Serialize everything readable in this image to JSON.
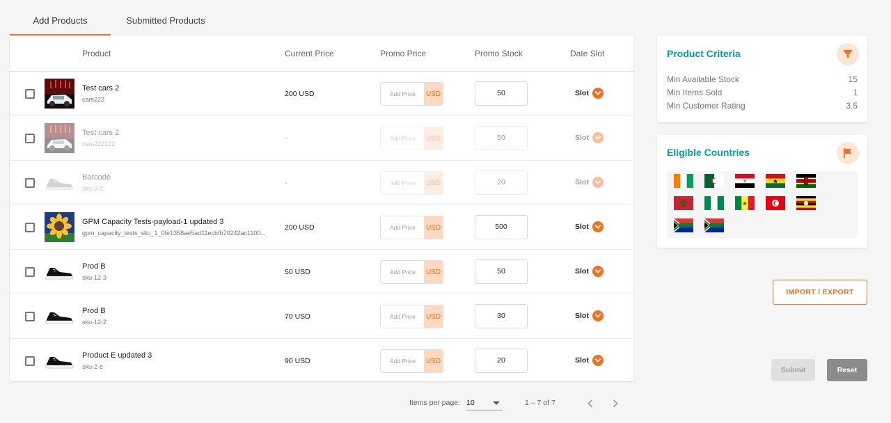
{
  "tabs": [
    {
      "label": "Add Products",
      "active": true
    },
    {
      "label": "Submitted Products",
      "active": false
    }
  ],
  "table": {
    "headers": {
      "product": "Product",
      "current_price": "Current Price",
      "promo_price": "Promo Price",
      "promo_stock": "Promo Stock",
      "date_slot": "Date Slot"
    },
    "rows": [
      {
        "name": "Test cars 2",
        "sku": "cars222",
        "current_price": "200 USD",
        "promo_placeholder": "Add Price",
        "currency": "USD",
        "stock": "50",
        "slot": "Slot",
        "disabled": false
      },
      {
        "name": "Test cars 2",
        "sku": "cars222222",
        "current_price": "-",
        "promo_placeholder": "Add Price",
        "currency": "USD",
        "stock": "50",
        "slot": "Slot",
        "disabled": true
      },
      {
        "name": "Barcode",
        "sku": "sku-3-2",
        "current_price": "-",
        "promo_placeholder": "Add Price",
        "currency": "USD",
        "stock": "20",
        "slot": "Slot",
        "disabled": true
      },
      {
        "name": "GPM Capacity Tests-payload-1 updated 3",
        "sku": "gpm_capacity_tests_sku_1_0fe1358ae5ad11ecbfb70242ac1100...",
        "current_price": "200 USD",
        "promo_placeholder": "Add Price",
        "currency": "USD",
        "stock": "500",
        "slot": "Slot",
        "disabled": false
      },
      {
        "name": "Prod B",
        "sku": "sku-12-3",
        "current_price": "50 USD",
        "promo_placeholder": "Add Price",
        "currency": "USD",
        "stock": "50",
        "slot": "Slot",
        "disabled": false
      },
      {
        "name": "Prod B",
        "sku": "sku-12-2",
        "current_price": "70 USD",
        "promo_placeholder": "Add Price",
        "currency": "USD",
        "stock": "30",
        "slot": "Slot",
        "disabled": false
      },
      {
        "name": "Product E updated 3",
        "sku": "sku-2-e",
        "current_price": "90 USD",
        "promo_placeholder": "Add Price",
        "currency": "USD",
        "stock": "20",
        "slot": "Slot",
        "disabled": false
      }
    ]
  },
  "pagination": {
    "items_per_page_label": "Items per page:",
    "items_per_page_value": "10",
    "range": "1 – 7 of 7"
  },
  "product_criteria": {
    "title": "Product Criteria",
    "icon": "filter-icon",
    "items": [
      {
        "label": "Min Available Stock",
        "value": "15"
      },
      {
        "label": "Min Items Sold",
        "value": "1"
      },
      {
        "label": "Min Customer Rating",
        "value": "3.5"
      }
    ]
  },
  "eligible_countries": {
    "title": "Eligible Countries",
    "icon": "flag-icon",
    "flags": [
      "ivory-coast-flag",
      "algeria-flag",
      "egypt-flag",
      "ghana-flag",
      "kenya-flag",
      "morocco-flag",
      "nigeria-flag",
      "senegal-flag",
      "tunisia-flag",
      "uganda-flag",
      "south-africa-flag",
      "south-africa-flag"
    ]
  },
  "buttons": {
    "import_export": "IMPORT / EXPORT",
    "submit": "Submit",
    "reset": "Reset"
  },
  "colors": {
    "accent": "#f37021",
    "title_teal": "#00a19a"
  }
}
